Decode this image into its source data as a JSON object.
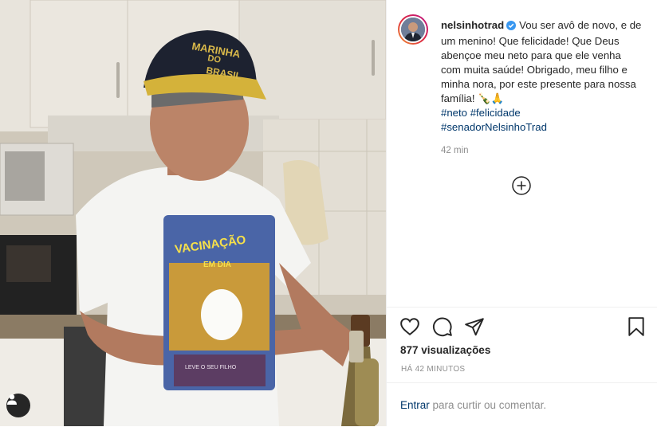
{
  "post": {
    "username": "nelsinhotrad",
    "caption": "Vou ser avô de novo, e de um menino! Que felicidade! Que Deus abençoe meu neto para que ele venha com muita saúde! Obrigado, meu filho e minha nora, por este presente para nossa família! 🍾🙏",
    "hashtags": [
      "#neto",
      "#felicidade",
      "#senadorNelsinhoTrad"
    ],
    "time": "42 min"
  },
  "media": {
    "cap_text_1": "MARINHA",
    "cap_text_2": "DO",
    "cap_text_3": "BRASIL",
    "shirt_text_1": "VACINAÇÃO",
    "shirt_text_2": "EM DIA",
    "shirt_text_3": "LEVE O SEU FILHO"
  },
  "stats": {
    "views": "877 visualizações",
    "ago": "Há 42 minutos"
  },
  "comment": {
    "link": "Entrar",
    "rest": " para curtir ou comentar."
  },
  "colors": {
    "link": "#00376b",
    "verified": "#3897f0",
    "muted": "#8e8e8e"
  },
  "icons": [
    "user-tag-icon",
    "verified-badge-icon",
    "plus-circle-icon",
    "heart-icon",
    "comment-icon",
    "share-icon",
    "bookmark-icon"
  ]
}
